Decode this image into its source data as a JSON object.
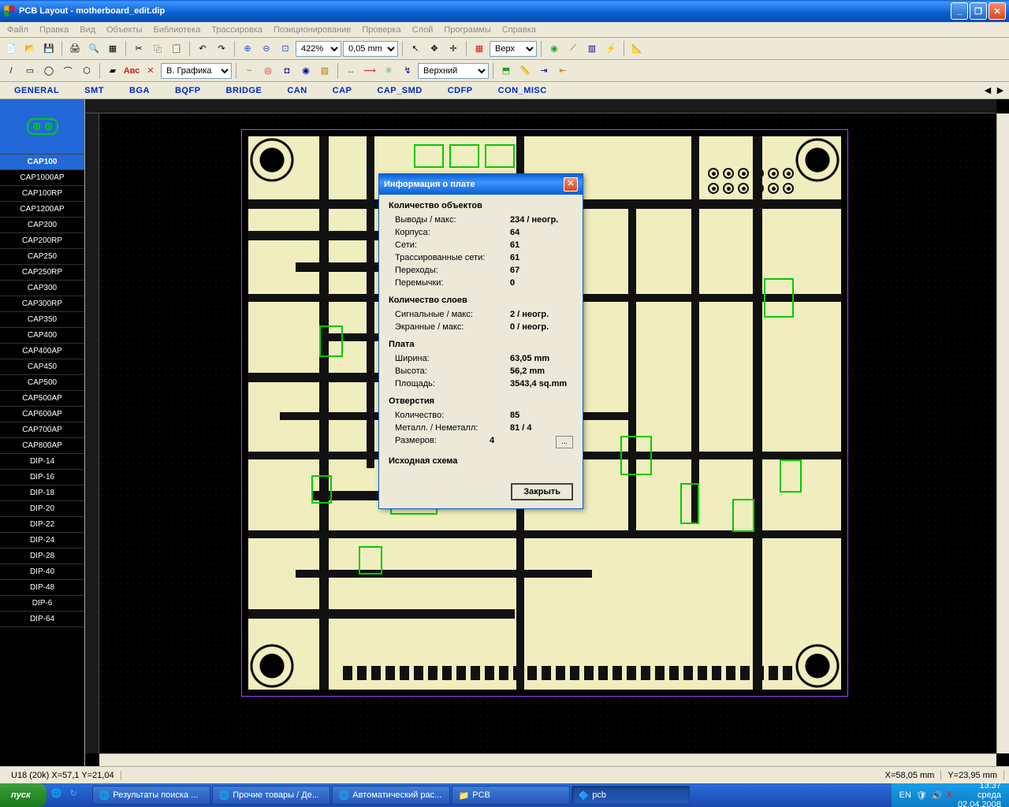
{
  "titlebar": {
    "app": "PCB Layout",
    "file": "motherboard_edit.dip"
  },
  "menu": [
    "Файл",
    "Правка",
    "Вид",
    "Объекты",
    "Библиотека",
    "Трассировка",
    "Позиционирование",
    "Проверка",
    "Слой",
    "Программы",
    "Справка"
  ],
  "toolbar1": {
    "zoom": "422%",
    "grid": "0,05 mm",
    "layer": "Верх"
  },
  "toolbar2": {
    "view": "В. Графика",
    "layer2": "Верхний"
  },
  "categories": [
    "GENERAL",
    "SMT",
    "BGA",
    "BQFP",
    "BRIDGE",
    "CAN",
    "CAP",
    "CAP_SMD",
    "CDFP",
    "CON_MISC"
  ],
  "library": [
    "CAP100",
    "CAP1000AP",
    "CAP100RP",
    "CAP1200AP",
    "CAP200",
    "CAP200RP",
    "CAP250",
    "CAP250RP",
    "CAP300",
    "CAP300RP",
    "CAP350",
    "CAP400",
    "CAP400AP",
    "CAP450",
    "CAP500",
    "CAP500AP",
    "CAP600AP",
    "CAP700AP",
    "CAP800AP",
    "DIP-14",
    "DIP-16",
    "DIP-18",
    "DIP-20",
    "DIP-22",
    "DIP-24",
    "DIP-28",
    "DIP-40",
    "DIP-48",
    "DIP-6",
    "DIP-64"
  ],
  "library_selected": 0,
  "dialog": {
    "title": "Информация о плате",
    "groups": [
      {
        "title": "Количество объектов",
        "rows": [
          {
            "lbl": "Выводы / макс:",
            "val": "234 / неогр."
          },
          {
            "lbl": "Корпуса:",
            "val": "64"
          },
          {
            "lbl": "Сети:",
            "val": "61"
          },
          {
            "lbl": "Трассированные сети:",
            "val": "61"
          },
          {
            "lbl": "Переходы:",
            "val": "67"
          },
          {
            "lbl": "Перемычки:",
            "val": "0"
          }
        ]
      },
      {
        "title": "Количество слоев",
        "rows": [
          {
            "lbl": "Сигнальные / макс:",
            "val": "2 / неогр."
          },
          {
            "lbl": "Экранные / макс:",
            "val": "0 / неогр."
          }
        ]
      },
      {
        "title": "Плата",
        "rows": [
          {
            "lbl": "Ширина:",
            "val": "63,05 mm"
          },
          {
            "lbl": "Высота:",
            "val": "56,2 mm"
          },
          {
            "lbl": "Площадь:",
            "val": "3543,4 sq.mm"
          }
        ]
      },
      {
        "title": "Отверстия",
        "rows": [
          {
            "lbl": "Количество:",
            "val": "85"
          },
          {
            "lbl": "Металл. / Неметалл:",
            "val": "81 / 4"
          },
          {
            "lbl": "Размеров:",
            "val": "4",
            "browse": true
          }
        ]
      },
      {
        "title": "Исходная схема",
        "rows": []
      }
    ],
    "close_btn": "Закрыть"
  },
  "status": {
    "left": "U18 (20k)  X=57,1  Y=21,04",
    "x": "X=58,05 mm",
    "y": "Y=23,95 mm"
  },
  "taskbar": {
    "start": "пуск",
    "tasks": [
      {
        "label": "Результаты поиска ...",
        "icon": "ie"
      },
      {
        "label": "Прочие товары / Де...",
        "icon": "ie"
      },
      {
        "label": "Автоматический рас...",
        "icon": "ie"
      },
      {
        "label": "PCB",
        "icon": "folder"
      },
      {
        "label": "pcb",
        "icon": "app",
        "active": true
      }
    ],
    "lang": "EN",
    "time": "13:37",
    "day": "среда",
    "date": "02.04.2008"
  }
}
